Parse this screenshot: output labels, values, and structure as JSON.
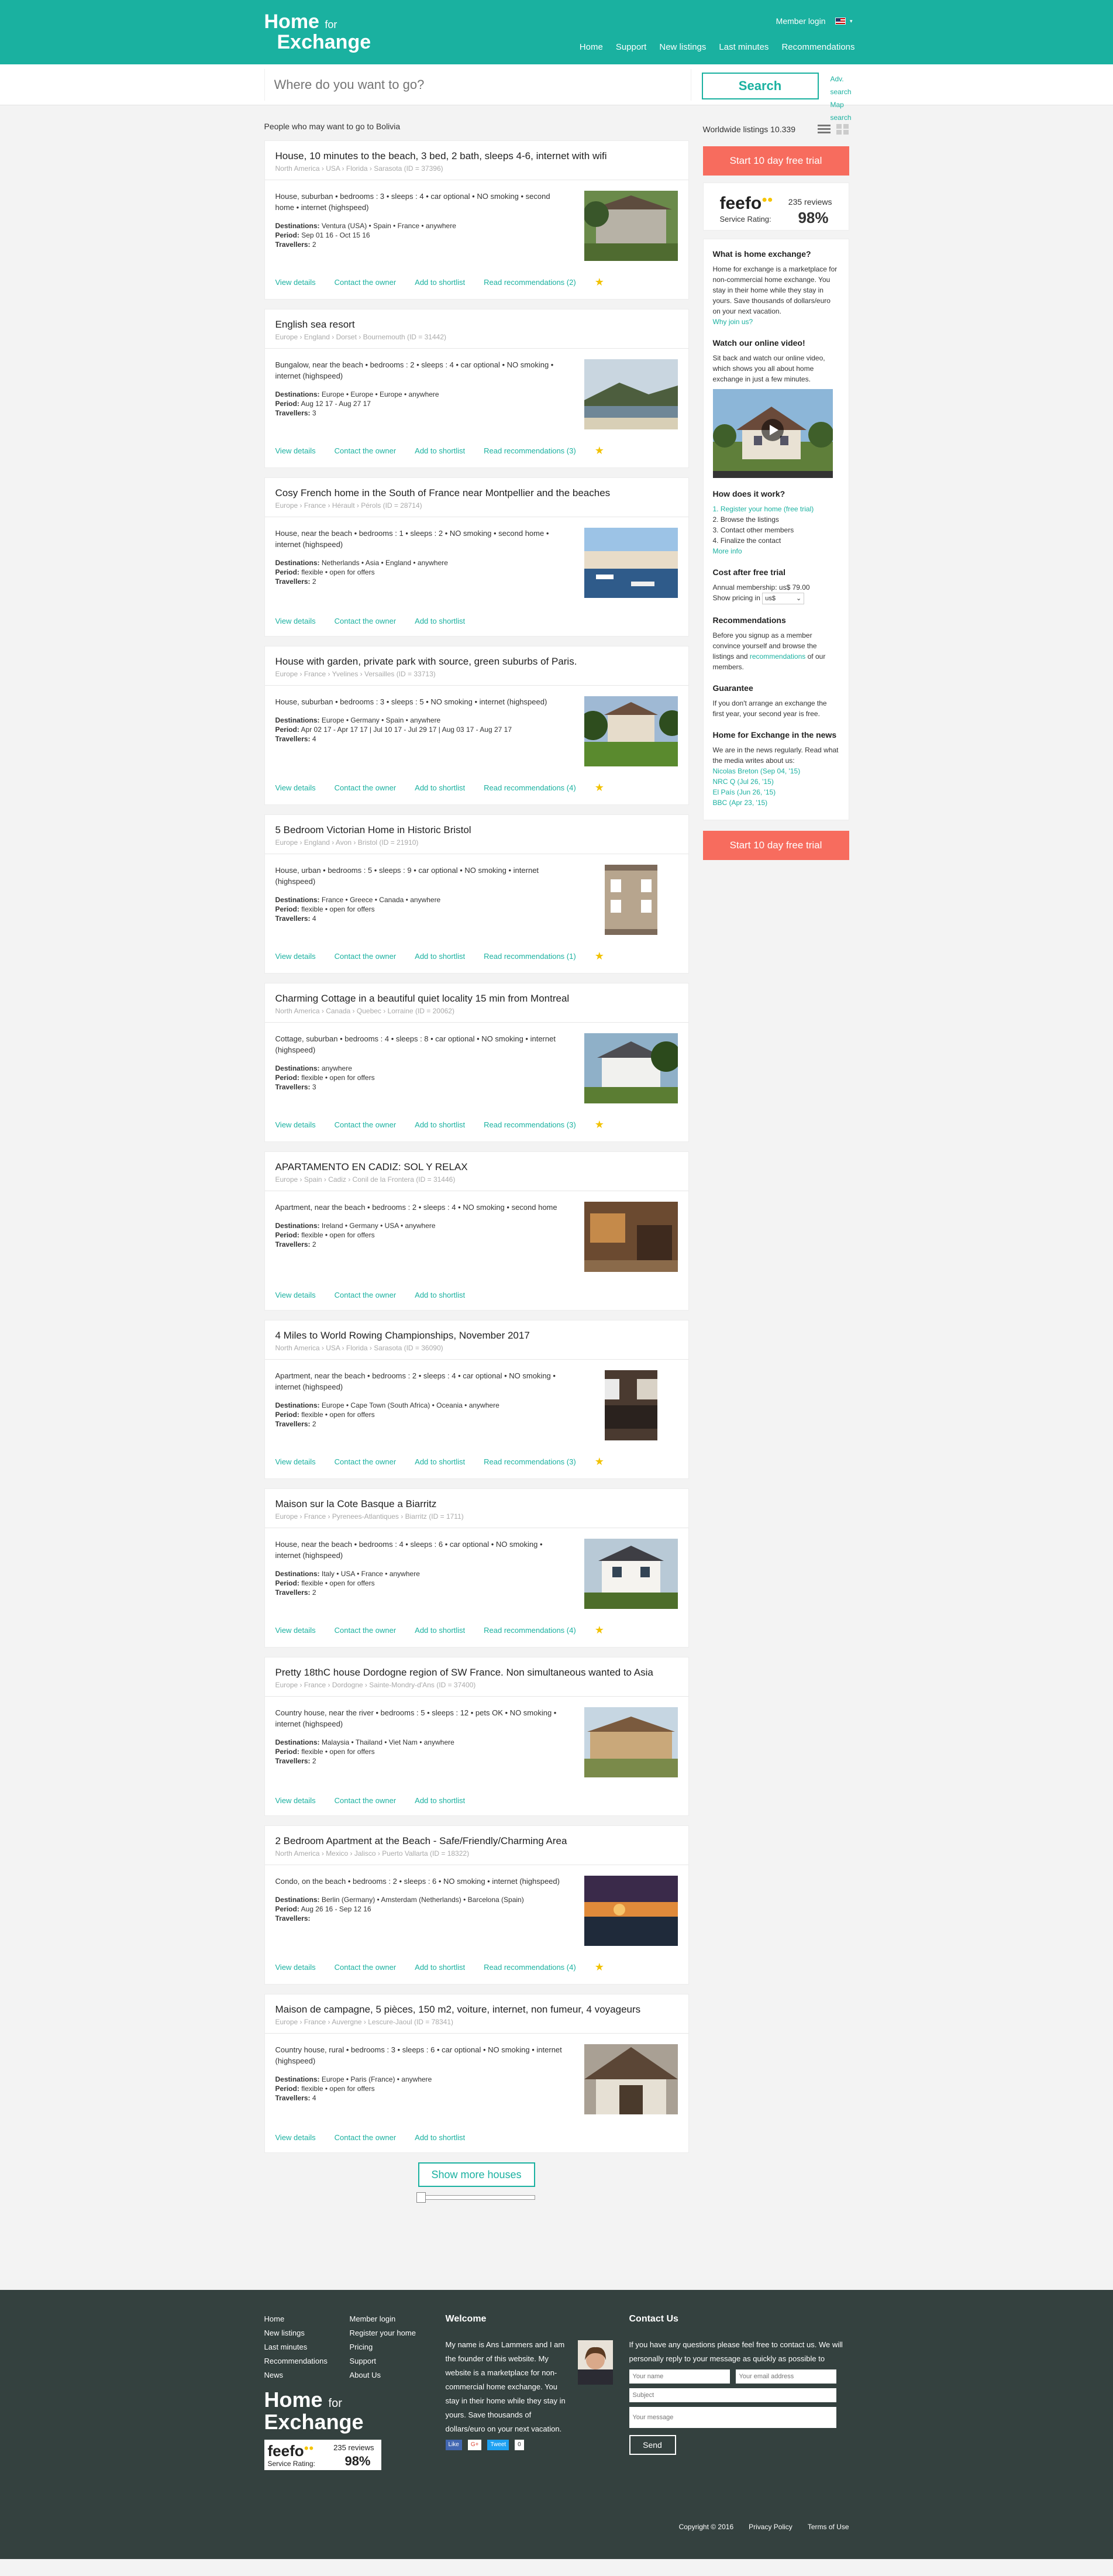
{
  "header": {
    "logo_line1": "Home",
    "logo_for": "for",
    "logo_line2": "Exchange",
    "member_login": "Member login",
    "nav": [
      "Home",
      "Support",
      "New listings",
      "Last minutes",
      "Recommendations"
    ]
  },
  "search": {
    "placeholder": "Where do you want to go?",
    "button": "Search",
    "adv_search": "Adv. search",
    "map_search": "Map search"
  },
  "results": {
    "heading": "People who may want to go to Bolivia",
    "actions": {
      "view": "View details",
      "contact": "Contact the owner",
      "shortlist": "Add to shortlist"
    },
    "show_more": "Show more houses"
  },
  "listings": [
    {
      "title": "House, 10 minutes to the beach, 3 bed, 2 bath, sleeps 4-6, internet with wifi",
      "location": "North America › USA › Florida › Sarasota (ID = 37396)",
      "desc": "House, suburban • bedrooms : 3 • sleeps : 4 • car optional • NO smoking • second home • internet (highspeed)",
      "destinations": "Ventura (USA) • Spain • France • anywhere",
      "period": "Sep 01 16 - Oct 15 16",
      "travellers": "2",
      "recs": "Read recommendations (2)",
      "star": true,
      "img": "garden"
    },
    {
      "title": "English sea resort",
      "location": "Europe › England › Dorset › Bournemouth (ID = 31442)",
      "desc": "Bungalow, near the beach • bedrooms : 2 • sleeps : 4 • car optional • NO smoking • internet (highspeed)",
      "destinations": "Europe • Europe • Europe • anywhere",
      "period": "Aug 12 17 - Aug 27 17",
      "travellers": "3",
      "recs": "Read recommendations (3)",
      "star": true,
      "img": "sea"
    },
    {
      "title": "Cosy French home in the South of France near Montpellier and the beaches",
      "location": "Europe › France › Hérault › Pérols (ID = 28714)",
      "desc": "House, near the beach • bedrooms : 1 • sleeps : 2 • NO smoking • second home • internet (highspeed)",
      "destinations": "Netherlands • Asia • England • anywhere",
      "period": "flexible • open for offers",
      "travellers": "2",
      "recs": "",
      "star": false,
      "img": "harbour"
    },
    {
      "title": "House with garden, private park with source, green suburbs of Paris.",
      "location": "Europe › France › Yvelines › Versailles (ID = 33713)",
      "desc": "House, suburban • bedrooms : 3 • sleeps : 5 • NO smoking • internet (highspeed)",
      "destinations": "Europe • Germany • Spain • anywhere",
      "period": "Apr 02 17 - Apr 17 17 | Jul 10 17 - Jul 29 17 | Aug 03 17 - Aug 27 17",
      "travellers": "4",
      "recs": "Read recommendations (4)",
      "star": true,
      "img": "lawn"
    },
    {
      "title": "5 Bedroom Victorian Home in Historic Bristol",
      "location": "Europe › England › Avon › Bristol (ID = 21910)",
      "desc": "House, urban • bedrooms : 5 • sleeps : 9 • car optional • NO smoking • internet (highspeed)",
      "destinations": "France • Greece • Canada • anywhere",
      "period": "flexible • open for offers",
      "travellers": "4",
      "recs": "Read recommendations (1)",
      "star": true,
      "img": "victorian"
    },
    {
      "title": "Charming Cottage in a beautiful quiet locality 15 min from Montreal",
      "location": "North America › Canada › Quebec › Lorraine (ID = 20062)",
      "desc": "Cottage, suburban • bedrooms : 4 • sleeps : 8 • car optional • NO smoking • internet (highspeed)",
      "destinations": "anywhere",
      "period": "flexible • open for offers",
      "travellers": "3",
      "recs": "Read recommendations (3)",
      "star": true,
      "img": "cottage"
    },
    {
      "title": "APARTAMENTO EN CADIZ: SOL Y RELAX",
      "location": "Europe › Spain › Cadiz › Conil de la Frontera (ID = 31446)",
      "desc": "Apartment, near the beach • bedrooms : 2 • sleeps : 4 • NO smoking • second home",
      "destinations": "Ireland • Germany • USA • anywhere",
      "period": "flexible • open for offers",
      "travellers": "2",
      "recs": "",
      "star": false,
      "img": "interior"
    },
    {
      "title": "4 Miles to World Rowing Championships, November 2017",
      "location": "North America › USA › Florida › Sarasota (ID = 36090)",
      "desc": "Apartment, near the beach • bedrooms : 2 • sleeps : 4 • car optional • NO smoking • internet (highspeed)",
      "destinations": "Europe • Cape Town (South Africa) • Oceania • anywhere",
      "period": "flexible • open for offers",
      "travellers": "2",
      "recs": "Read recommendations (3)",
      "star": true,
      "img": "kitchen"
    },
    {
      "title": "Maison sur la Cote Basque a Biarritz",
      "location": "Europe › France › Pyrenees-Atlantiques › Biarritz (ID = 1711)",
      "desc": "House, near the beach • bedrooms : 4 • sleeps : 6 • car optional • NO smoking • internet (highspeed)",
      "destinations": "Italy • USA • France • anywhere",
      "period": "flexible • open for offers",
      "travellers": "2",
      "recs": "Read recommendations (4)",
      "star": true,
      "img": "villa"
    },
    {
      "title": "Pretty 18thC house Dordogne region of SW France. Non simultaneous wanted to Asia",
      "location": "Europe › France › Dordogne › Sainte-Mondry-d'Ans (ID = 37400)",
      "desc": "Country house, near the river • bedrooms : 5 • sleeps : 12 • pets OK • NO smoking • internet (highspeed)",
      "destinations": "Malaysia • Thailand • Viet Nam • anywhere",
      "period": "flexible • open for offers",
      "travellers": "2",
      "recs": "",
      "star": false,
      "img": "stone"
    },
    {
      "title": "2 Bedroom Apartment at the Beach - Safe/Friendly/Charming Area",
      "location": "North America › Mexico › Jalisco › Puerto Vallarta (ID = 18322)",
      "desc": "Condo, on the beach • bedrooms : 2 • sleeps : 6 • NO smoking • internet (highspeed)",
      "destinations": "Berlin (Germany) • Amsterdam (Netherlands) • Barcelona (Spain)",
      "period": "Aug 26 16 - Sep 12 16",
      "travellers": "",
      "recs": "Read recommendations (4)",
      "star": true,
      "img": "sunset"
    },
    {
      "title": "Maison de campagne, 5 pièces, 150 m2, voiture, internet, non fumeur, 4 voyageurs",
      "location": "Europe › France › Auvergne › Lescure-Jaoul (ID = 78341)",
      "desc": "Country house, rural • bedrooms : 3 • sleeps : 6 • car optional • NO smoking • internet (highspeed)",
      "destinations": "Europe • Paris (France) • anywhere",
      "period": "flexible • open for offers",
      "travellers": "4",
      "recs": "",
      "star": false,
      "img": "barn"
    }
  ],
  "labels": {
    "destinations": "Destinations:",
    "period": "Period:",
    "travellers": "Travellers:"
  },
  "sidebar": {
    "worldwide": "Worldwide listings 10.339",
    "trial": "Start 10 day free trial",
    "feefo": {
      "logo": "feefo",
      "service_rating": "Service Rating:",
      "reviews": "235 reviews",
      "score": "98%"
    },
    "what_title": "What is home exchange?",
    "what_text": "Home for exchange is a marketplace for non-commercial home exchange. You stay in their home while they stay in yours. Save thousands of dollars/euro on your next vacation.",
    "why_link": "Why join us?",
    "video_title": "Watch our online video!",
    "video_text": "Sit back and watch our online video, which shows you all about home exchange in just a few minutes.",
    "how_title": "How does it work?",
    "how_steps": [
      "1. Register your home (free trial)",
      "2. Browse the listings",
      "3. Contact other members",
      "4. Finalize the contact"
    ],
    "more_info": "More info",
    "cost_title": "Cost after free trial",
    "cost_text": "Annual membership: us$ 79.00",
    "show_pricing": "Show pricing in",
    "currency": "us$",
    "recs_title": "Recommendations",
    "recs_text_a": "Before you signup as a member convince yourself and browse the listings and",
    "recs_link": "recommendations",
    "recs_text_b": "of our members.",
    "guarantee_title": "Guarantee",
    "guarantee_text": "If you don't arrange an exchange the first year, your second year is free.",
    "news_title": "Home for Exchange in the news",
    "news_text": "We are in the news regularly. Read what the media writes about us:",
    "news_links": [
      "Nicolas Breton (Sep 04, '15)",
      "NRC Q (Jul 26, '15)",
      "El País (Jun 26, '15)",
      "BBC (Apr 23, '15)"
    ]
  },
  "footer": {
    "col1": [
      "Home",
      "New listings",
      "Last minutes",
      "Recommendations",
      "News"
    ],
    "col2": [
      "Member login",
      "Register your home",
      "Pricing",
      "Support",
      "About Us"
    ],
    "welcome_title": "Welcome",
    "welcome_text": "My name is Ans Lammers and I am the founder of this website. My website is a marketplace for non-commercial home exchange. You stay in their home while they stay in yours. Save thousands of dollars/euro on your next vacation.",
    "social": [
      "Like",
      "G+",
      "Tweet",
      "0"
    ],
    "contact_title": "Contact Us",
    "contact_text": "If you have any questions please feel free to contact us. We will personally reply to your message as quickly as possible to assist you.",
    "name_ph": "Your name",
    "email_ph": "Your email address",
    "subject_ph": "Subject",
    "message_ph": "Your message",
    "send": "Send",
    "copyright": "Copyright © 2016",
    "privacy": "Privacy Policy",
    "terms": "Terms of Use"
  }
}
